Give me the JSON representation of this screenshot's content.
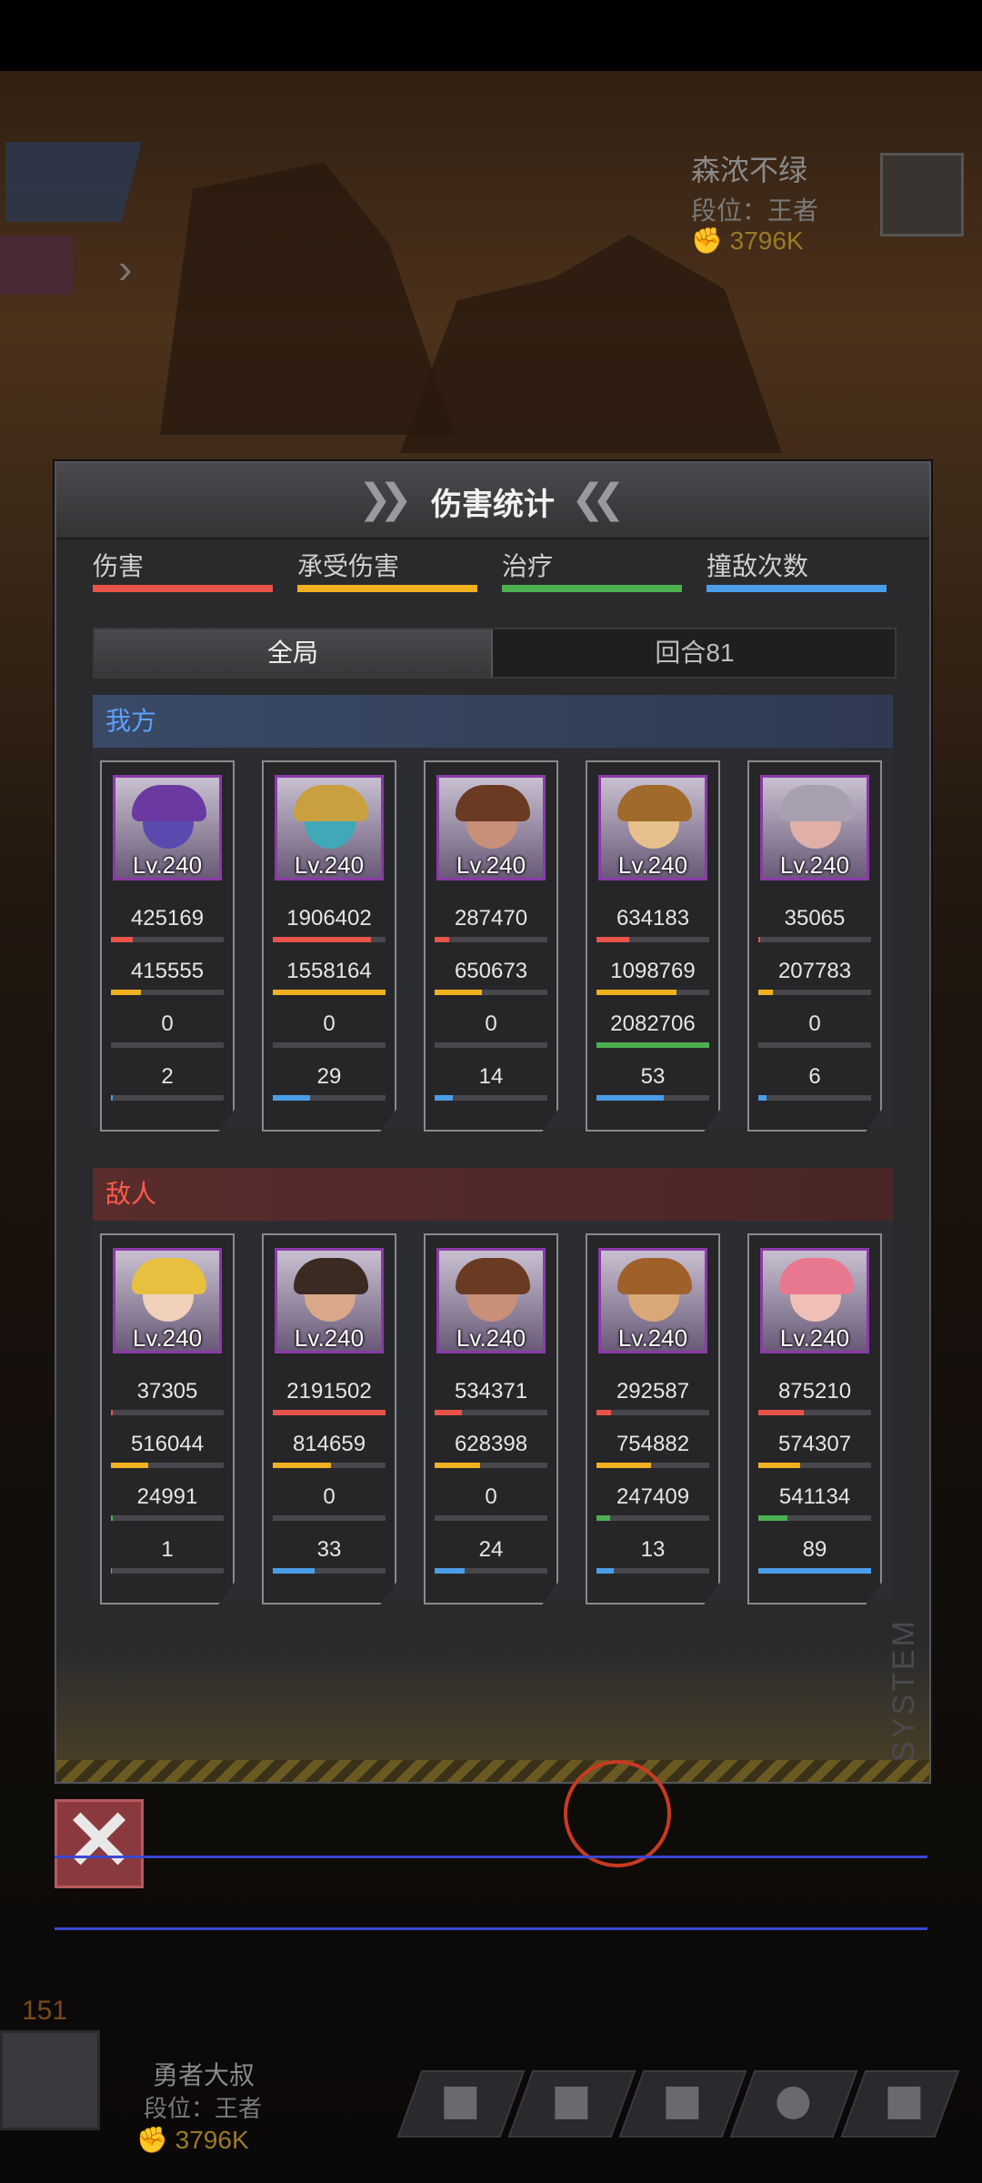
{
  "opponent": {
    "name": "森浓不绿",
    "rank": "段位：王者",
    "power": "3796K"
  },
  "player": {
    "name": "勇者大叔",
    "rank": "段位：王者",
    "power": "3796K"
  },
  "side_counter": "151",
  "panel": {
    "title": "伤害统计",
    "legend": [
      {
        "label": "伤害",
        "color": "#e8534a"
      },
      {
        "label": "承受伤害",
        "color": "#f0b020"
      },
      {
        "label": "治疗",
        "color": "#4cb050"
      },
      {
        "label": "撞敌次数",
        "color": "#4a9ee8"
      }
    ],
    "tabs": {
      "all": "全局",
      "round": "回合81"
    },
    "system_label": "SYSTEM"
  },
  "ally": {
    "label": "我方",
    "heroes": [
      {
        "level": "Lv.240",
        "damage": "425169",
        "damage_frac": 0.19,
        "taken": "415555",
        "taken_frac": 0.27,
        "heal": "0",
        "heal_frac": 0,
        "hits": "2",
        "hits_frac": 0.02,
        "hair": "#6a3aa0",
        "face": "#5a4ab0"
      },
      {
        "level": "Lv.240",
        "damage": "1906402",
        "damage_frac": 0.87,
        "taken": "1558164",
        "taken_frac": 1.0,
        "heal": "0",
        "heal_frac": 0,
        "hits": "29",
        "hits_frac": 0.33,
        "hair": "#c8a040",
        "face": "#40a8b8"
      },
      {
        "level": "Lv.240",
        "damage": "287470",
        "damage_frac": 0.13,
        "taken": "650673",
        "taken_frac": 0.42,
        "heal": "0",
        "heal_frac": 0,
        "hits": "14",
        "hits_frac": 0.16,
        "hair": "#6a3a22",
        "face": "#c89078"
      },
      {
        "level": "Lv.240",
        "damage": "634183",
        "damage_frac": 0.29,
        "taken": "1098769",
        "taken_frac": 0.71,
        "heal": "2082706",
        "heal_frac": 1.0,
        "hits": "53",
        "hits_frac": 0.6,
        "hair": "#a06a2a",
        "face": "#e8c090"
      },
      {
        "level": "Lv.240",
        "damage": "35065",
        "damage_frac": 0.02,
        "taken": "207783",
        "taken_frac": 0.13,
        "heal": "0",
        "heal_frac": 0,
        "hits": "6",
        "hits_frac": 0.07,
        "hair": "#a8a0b0",
        "face": "#e0b0a8"
      }
    ]
  },
  "enemy": {
    "label": "敌人",
    "heroes": [
      {
        "level": "Lv.240",
        "damage": "37305",
        "damage_frac": 0.02,
        "taken": "516044",
        "taken_frac": 0.33,
        "heal": "24991",
        "heal_frac": 0.02,
        "hits": "1",
        "hits_frac": 0.01,
        "hair": "#e8c040",
        "face": "#f0d0b8"
      },
      {
        "level": "Lv.240",
        "damage": "2191502",
        "damage_frac": 1.0,
        "taken": "814659",
        "taken_frac": 0.52,
        "heal": "0",
        "heal_frac": 0,
        "hits": "33",
        "hits_frac": 0.37,
        "hair": "#3a2a22",
        "face": "#d8a888"
      },
      {
        "level": "Lv.240",
        "damage": "534371",
        "damage_frac": 0.24,
        "taken": "628398",
        "taken_frac": 0.4,
        "heal": "0",
        "heal_frac": 0,
        "hits": "24",
        "hits_frac": 0.27,
        "hair": "#6a3a22",
        "face": "#c89078"
      },
      {
        "level": "Lv.240",
        "damage": "292587",
        "damage_frac": 0.13,
        "taken": "754882",
        "taken_frac": 0.48,
        "heal": "247409",
        "heal_frac": 0.12,
        "hits": "13",
        "hits_frac": 0.15,
        "hair": "#a0602a",
        "face": "#d8a878"
      },
      {
        "level": "Lv.240",
        "damage": "875210",
        "damage_frac": 0.4,
        "taken": "574307",
        "taken_frac": 0.37,
        "heal": "541134",
        "heal_frac": 0.26,
        "hits": "89",
        "hits_frac": 1.0,
        "hair": "#e87890",
        "face": "#f0c0b8"
      }
    ]
  }
}
